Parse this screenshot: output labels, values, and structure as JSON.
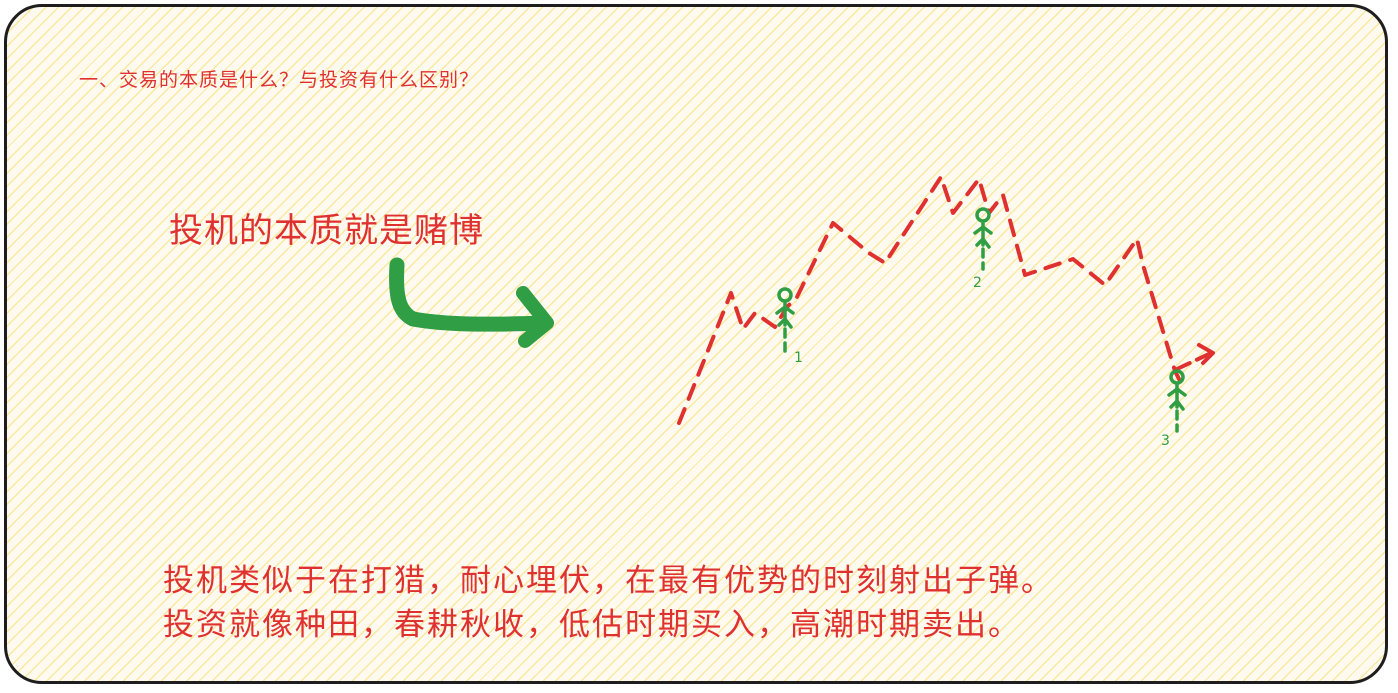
{
  "heading": "一、交易的本质是什么？与投资有什么区别？",
  "claim": "投机的本质就是赌博",
  "explanation": {
    "line1": "投机类似于在打猎，耐心埋伏，在最有优势的时刻射出子弹。",
    "line2": "投资就像种田，春耕秋收，低估时期买入，高潮时期卖出。"
  },
  "markers": [
    {
      "label": "1"
    },
    {
      "label": "2"
    },
    {
      "label": "3"
    }
  ],
  "colors": {
    "text": "#e03131",
    "price_line": "#e03131",
    "arrow": "#2f9e44",
    "stick_figure": "#2f9e44",
    "hatch": "#f5d63c",
    "border": "#1e1e1e"
  }
}
